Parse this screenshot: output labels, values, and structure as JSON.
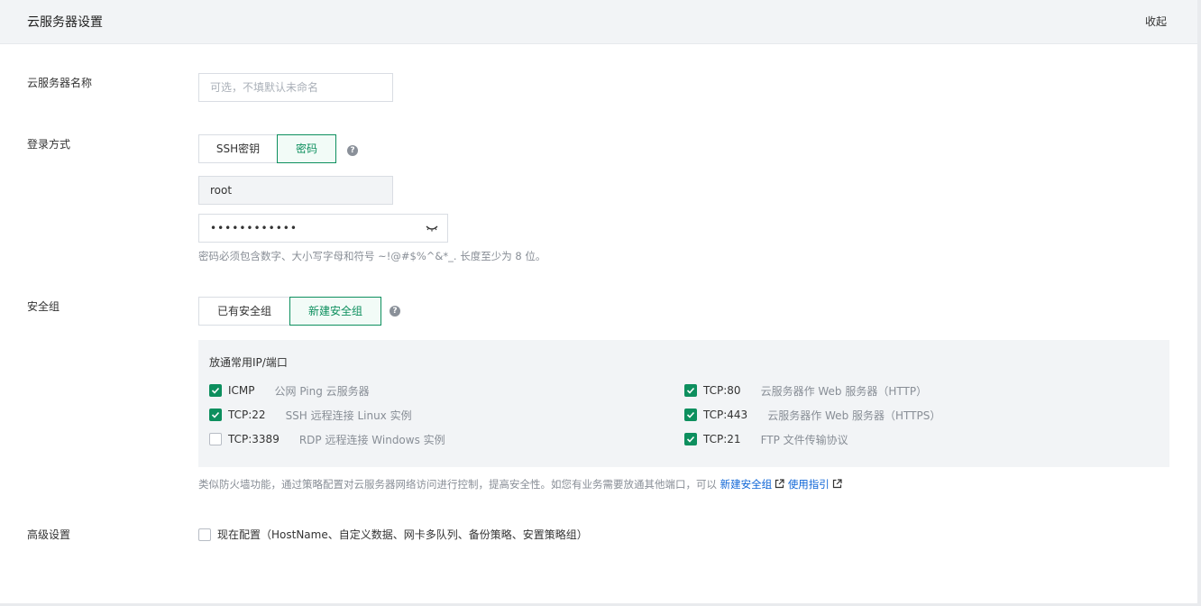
{
  "header": {
    "title": "云服务器设置",
    "collapse_label": "收起"
  },
  "server_name": {
    "label": "云服务器名称",
    "placeholder": "可选，不填默认未命名",
    "value": ""
  },
  "login": {
    "label": "登录方式",
    "options": [
      "SSH密钥",
      "密码"
    ],
    "selected": "密码",
    "username": "root",
    "password_mask": "••••••••••••",
    "hint": "密码必须包含数字、大小写字母和符号 ~!@#$%^&*_. 长度至少为 8 位。"
  },
  "security_group": {
    "label": "安全组",
    "options": [
      "已有安全组",
      "新建安全组"
    ],
    "selected": "新建安全组",
    "box_title": "放通常用IP/端口",
    "ports": [
      {
        "name": "ICMP",
        "desc": "公网 Ping 云服务器",
        "checked": true
      },
      {
        "name": "TCP:22",
        "desc": "SSH 远程连接 Linux 实例",
        "checked": true
      },
      {
        "name": "TCP:3389",
        "desc": "RDP 远程连接 Windows 实例",
        "checked": false
      },
      {
        "name": "TCP:80",
        "desc": "云服务器作 Web 服务器（HTTP）",
        "checked": true
      },
      {
        "name": "TCP:443",
        "desc": "云服务器作 Web 服务器（HTTPS）",
        "checked": true
      },
      {
        "name": "TCP:21",
        "desc": "FTP 文件传输协议",
        "checked": true
      }
    ],
    "hint": "类似防火墙功能，通过策略配置对云服务器网络访问进行控制，提高安全性。如您有业务需要放通其他端口，可以",
    "link_new": "新建安全组",
    "link_guide": "使用指引"
  },
  "advanced": {
    "label": "高级设置",
    "checkbox_label": "现在配置（HostName、自定义数据、网卡多队列、备份策略、安置策略组）",
    "checked": false
  },
  "colors": {
    "accent": "#0d8f5e",
    "link": "#0b63d6",
    "muted": "#888e96"
  },
  "icons": [
    "help-icon",
    "eye-closed-icon",
    "external-link-icon",
    "checkmark-icon"
  ]
}
